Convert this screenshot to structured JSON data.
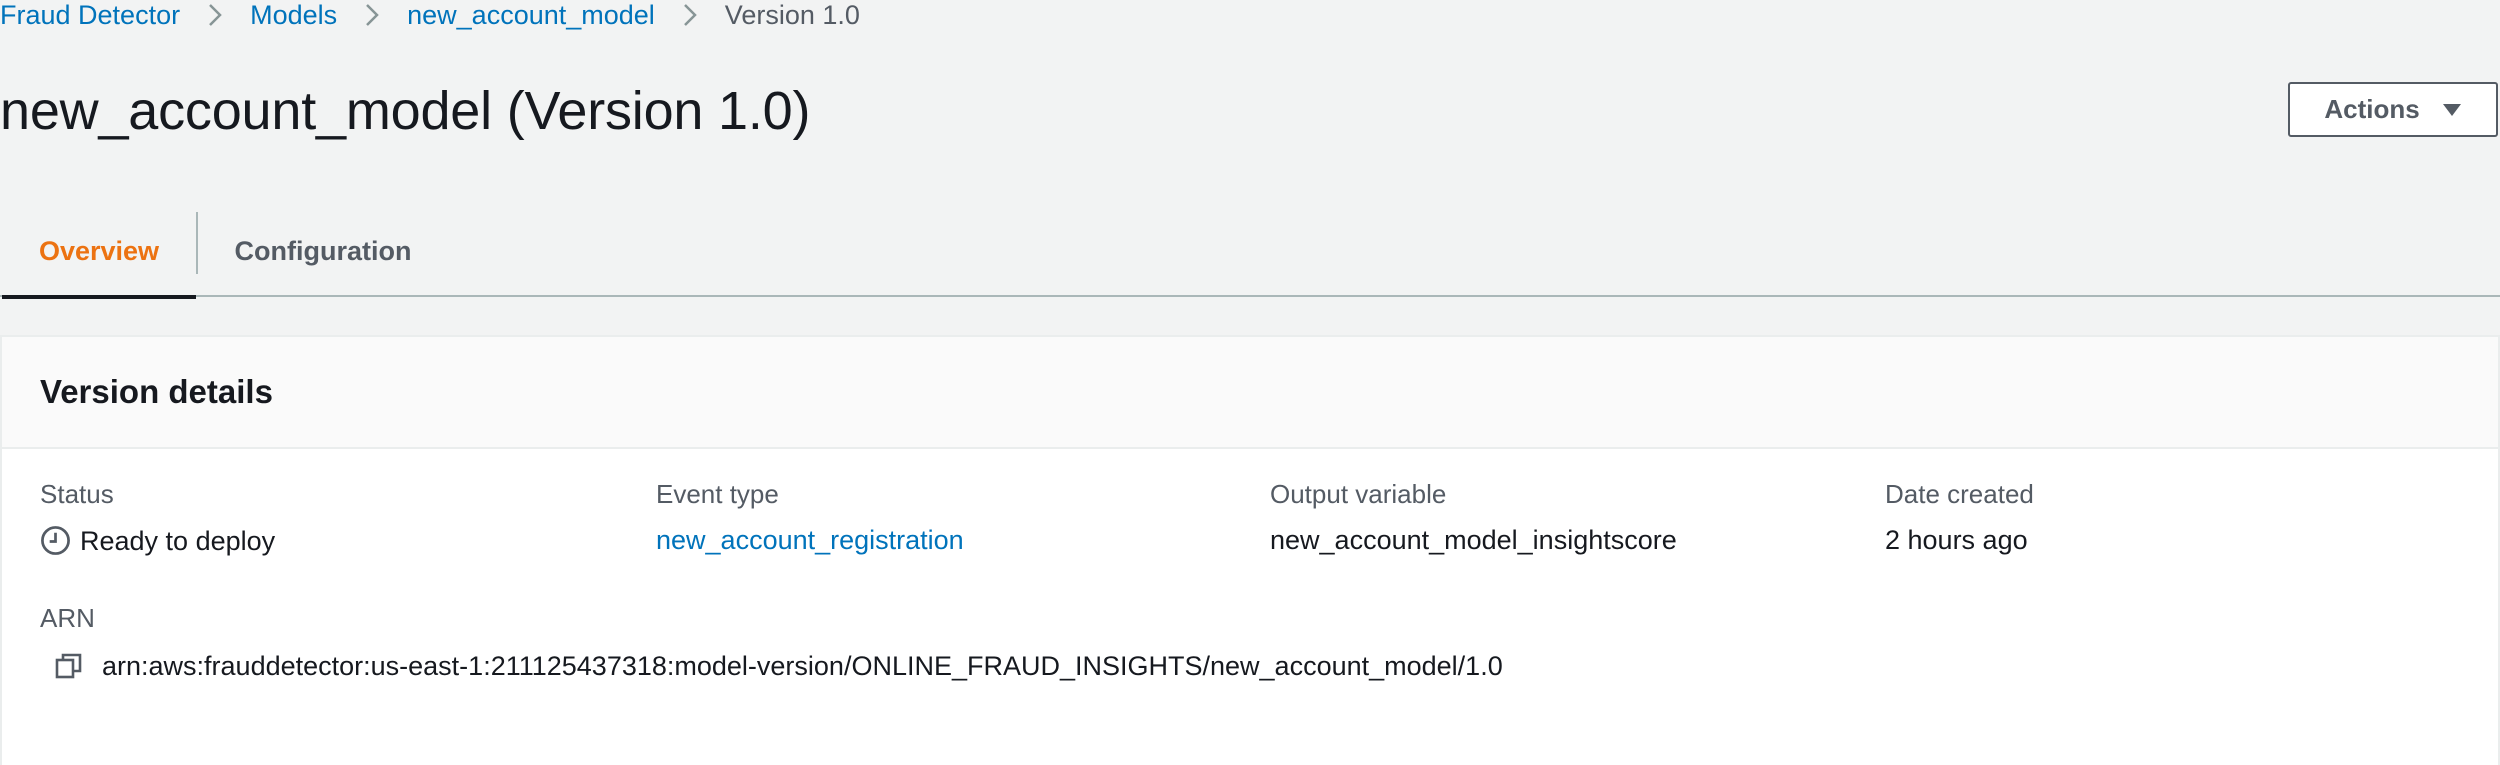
{
  "breadcrumb": {
    "items": [
      {
        "label": "Fraud Detector"
      },
      {
        "label": "Models"
      },
      {
        "label": "new_account_model"
      }
    ],
    "current": "Version 1.0"
  },
  "page": {
    "title": "new_account_model (Version 1.0)"
  },
  "actions": {
    "label": "Actions",
    "icon": "caret-down-icon"
  },
  "tabs": [
    {
      "label": "Overview",
      "active": true
    },
    {
      "label": "Configuration",
      "active": false
    }
  ],
  "panel": {
    "title": "Version details",
    "fields": {
      "status": {
        "label": "Status",
        "value": "Ready to deploy",
        "icon": "clock-icon"
      },
      "event_type": {
        "label": "Event type",
        "value": "new_account_registration"
      },
      "output_variable": {
        "label": "Output variable",
        "value": "new_account_model_insightscore"
      },
      "date_created": {
        "label": "Date created",
        "value": "2 hours ago"
      }
    },
    "arn": {
      "label": "ARN",
      "value": "arn:aws:frauddetector:us-east-1:211125437318:model-version/ONLINE_FRAUD_INSIGHTS/new_account_model/1.0",
      "icon": "copy-icon"
    }
  },
  "colors": {
    "link": "#0073bb",
    "active_tab": "#ec7211",
    "text": "#16191f",
    "muted": "#545b64",
    "background": "#f2f3f3"
  }
}
